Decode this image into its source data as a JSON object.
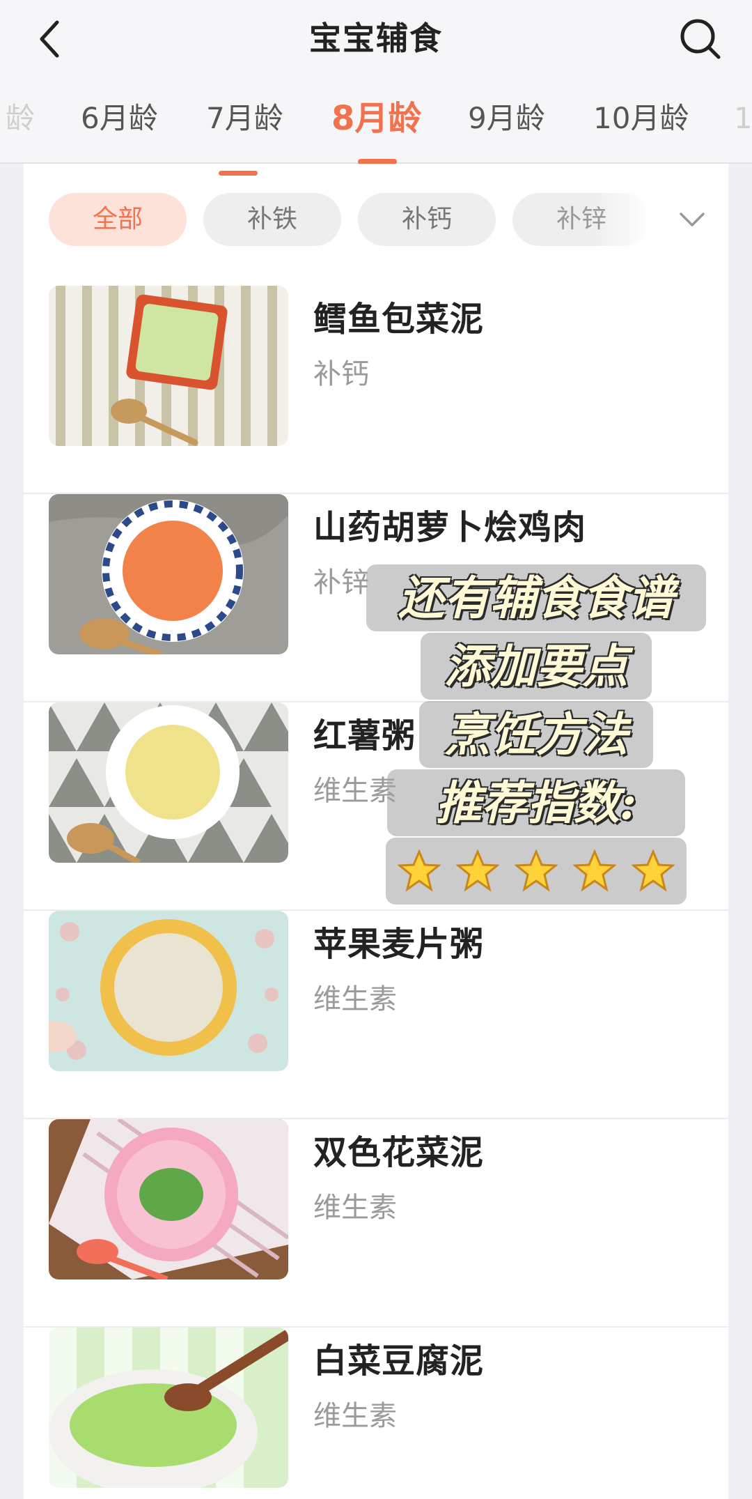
{
  "header": {
    "title": "宝宝辅食"
  },
  "age_tabs": [
    {
      "label": "龄"
    },
    {
      "label": "6月龄"
    },
    {
      "label": "7月龄"
    },
    {
      "label": "8月龄"
    },
    {
      "label": "9月龄"
    },
    {
      "label": "10月龄"
    },
    {
      "label": "1"
    }
  ],
  "age_tab_selected": "8月龄",
  "filters": [
    {
      "label": "全部"
    },
    {
      "label": "补铁"
    },
    {
      "label": "补钙"
    },
    {
      "label": "补锌"
    }
  ],
  "filter_selected": "全部",
  "recipes": [
    {
      "name": "鳕鱼包菜泥",
      "tag": "补钙"
    },
    {
      "name": "山药胡萝卜烩鸡肉",
      "tag": "补锌"
    },
    {
      "name": "红薯粥",
      "tag": "维生素"
    },
    {
      "name": "苹果麦片粥",
      "tag": "维生素"
    },
    {
      "name": "双色花菜泥",
      "tag": "维生素"
    },
    {
      "name": "白菜豆腐泥",
      "tag": "维生素"
    }
  ],
  "overlay": {
    "lines": [
      "还有辅食食谱",
      "添加要点",
      "烹饪方法",
      "推荐指数:"
    ],
    "stars": 5
  },
  "colors": {
    "accent": "#f2724e",
    "chip_active_bg": "#fde2da"
  }
}
